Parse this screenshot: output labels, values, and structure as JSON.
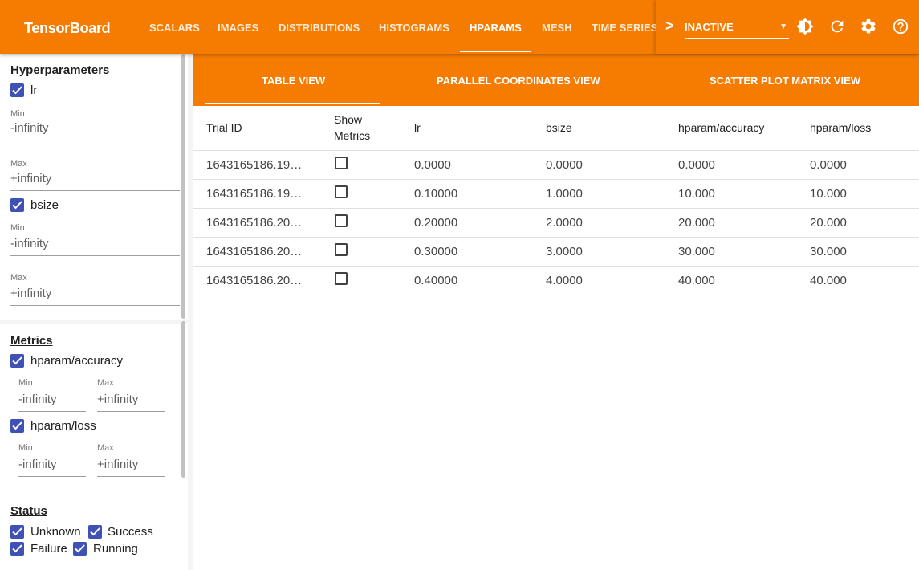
{
  "app": {
    "brand": "TensorBoard"
  },
  "nav": {
    "tabs": [
      "SCALARS",
      "IMAGES",
      "DISTRIBUTIONS",
      "HISTOGRAMS",
      "HPARAMS",
      "MESH",
      "TIME SERIES"
    ],
    "active": "HPARAMS"
  },
  "toolbar": {
    "chevron": ">",
    "run_state": "INACTIVE"
  },
  "icons": {
    "theme": "brightness-icon",
    "reload": "refresh-icon",
    "settings": "gear-icon",
    "help": "help-icon"
  },
  "sidebar": {
    "hyperparameters": {
      "title": "Hyperparameters",
      "items": [
        {
          "label": "lr",
          "min_label": "Min",
          "min": "-infinity",
          "max_label": "Max",
          "max": "+infinity"
        },
        {
          "label": "bsize",
          "min_label": "Min",
          "min": "-infinity",
          "max_label": "Max",
          "max": "+infinity"
        }
      ]
    },
    "metrics": {
      "title": "Metrics",
      "items": [
        {
          "label": "hparam/accuracy",
          "min_label": "Min",
          "min": "-infinity",
          "max_label": "Max",
          "max": "+infinity"
        },
        {
          "label": "hparam/loss",
          "min_label": "Min",
          "min": "-infinity",
          "max_label": "Max",
          "max": "+infinity"
        }
      ]
    },
    "status": {
      "title": "Status",
      "items": [
        "Unknown",
        "Success",
        "Failure",
        "Running"
      ]
    }
  },
  "views": {
    "tabs": [
      "TABLE VIEW",
      "PARALLEL COORDINATES VIEW",
      "SCATTER PLOT MATRIX VIEW"
    ],
    "active": "TABLE VIEW"
  },
  "table": {
    "headers": {
      "trial": "Trial ID",
      "show1": "Show",
      "show2": "Metrics",
      "lr": "lr",
      "bsize": "bsize",
      "acc": "hparam/accuracy",
      "loss": "hparam/loss"
    },
    "rows": [
      {
        "trial": "1643165186.19…",
        "lr": "0.0000",
        "bsize": "0.0000",
        "acc": "0.0000",
        "loss": "0.0000"
      },
      {
        "trial": "1643165186.19…",
        "lr": "0.10000",
        "bsize": "1.0000",
        "acc": "10.000",
        "loss": "10.000"
      },
      {
        "trial": "1643165186.20…",
        "lr": "0.20000",
        "bsize": "2.0000",
        "acc": "20.000",
        "loss": "20.000"
      },
      {
        "trial": "1643165186.20…",
        "lr": "0.30000",
        "bsize": "3.0000",
        "acc": "30.000",
        "loss": "30.000"
      },
      {
        "trial": "1643165186.20…",
        "lr": "0.40000",
        "bsize": "4.0000",
        "acc": "40.000",
        "loss": "40.000"
      }
    ]
  },
  "colors": {
    "primary": "#f57c00",
    "checkbox": "#3f51b5"
  }
}
